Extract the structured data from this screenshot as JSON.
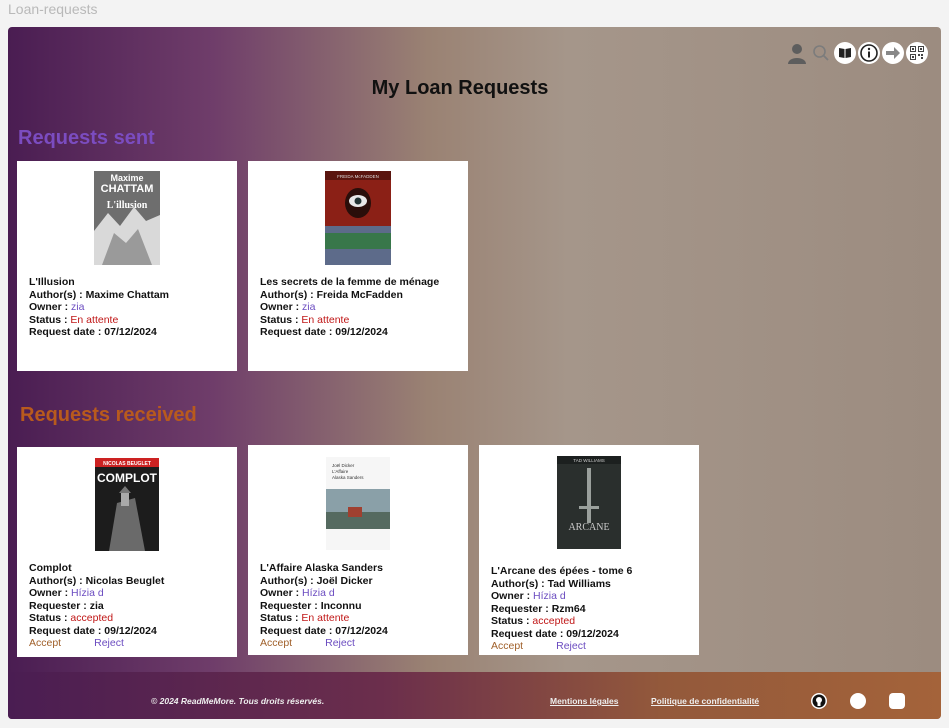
{
  "window": {
    "title": "Loan-requests"
  },
  "header": {
    "icons": [
      "user-icon",
      "search-icon",
      "book-icon",
      "info-icon",
      "arrow-right-icon",
      "qr-code-icon"
    ]
  },
  "page": {
    "title": "My Loan Requests"
  },
  "sent": {
    "title": "Requests sent",
    "cards": [
      {
        "title": "L'Illusion",
        "author": "Maxime Chattam",
        "owner": "zia",
        "status": "En attente",
        "date": "07/12/2024"
      },
      {
        "title": "Les secrets de la femme de ménage",
        "author": "Freida McFadden",
        "owner": "zia",
        "status": "En attente",
        "date": "09/12/2024"
      }
    ]
  },
  "received": {
    "title": "Requests received",
    "cards": [
      {
        "title": "Complot",
        "author": "Nicolas Beuglet",
        "owner": "Hízia d",
        "requester": "zia",
        "status": "accepted",
        "date": "09/12/2024",
        "accept": "Accept",
        "reject": "Reject"
      },
      {
        "title": "L'Affaire Alaska Sanders",
        "author": "Joël Dicker",
        "owner": "Hízia d",
        "requester": "Inconnu",
        "status": "En attente",
        "date": "07/12/2024",
        "accept": "Accept",
        "reject": "Reject"
      },
      {
        "title": "L'Arcane des épées - tome 6",
        "author": "Tad Williams",
        "owner": "Hízia d",
        "requester": "Rzm64",
        "status": "accepted",
        "date": "09/12/2024",
        "accept": "Accept",
        "reject": "Reject"
      }
    ]
  },
  "labels": {
    "author": "Author(s) : ",
    "owner": "Owner : ",
    "requester": "Requester : ",
    "status": "Status : ",
    "date": "Request date : "
  },
  "covers": {
    "illusion": {
      "line1": "Maxime",
      "line2": "CHATTAM",
      "line3": "L'illusion"
    },
    "secrets": {
      "top": "FREIDA McFADDEN"
    },
    "complot": {
      "top": "NICOLAS BEUGLET",
      "main": "COMPLOT"
    },
    "alaska": {
      "line1": "Joël Dicker",
      "line2": "L'Affaire",
      "line3": "Alaska Sanders"
    },
    "arcane": {
      "top": "TAD WILLIAMS",
      "main": "ARCANE"
    }
  },
  "footer": {
    "copyright": "© 2024 ReadMeMore. Tous droits réservés.",
    "legal": "Mentions légales",
    "privacy": "Politique de confidentialité",
    "icons": [
      "github-icon",
      "social-icon",
      "chat-icon"
    ]
  },
  "colors": {
    "accent_purple": "#7b4cc0",
    "accent_orange": "#b85a1d",
    "status_red": "#c01616"
  }
}
